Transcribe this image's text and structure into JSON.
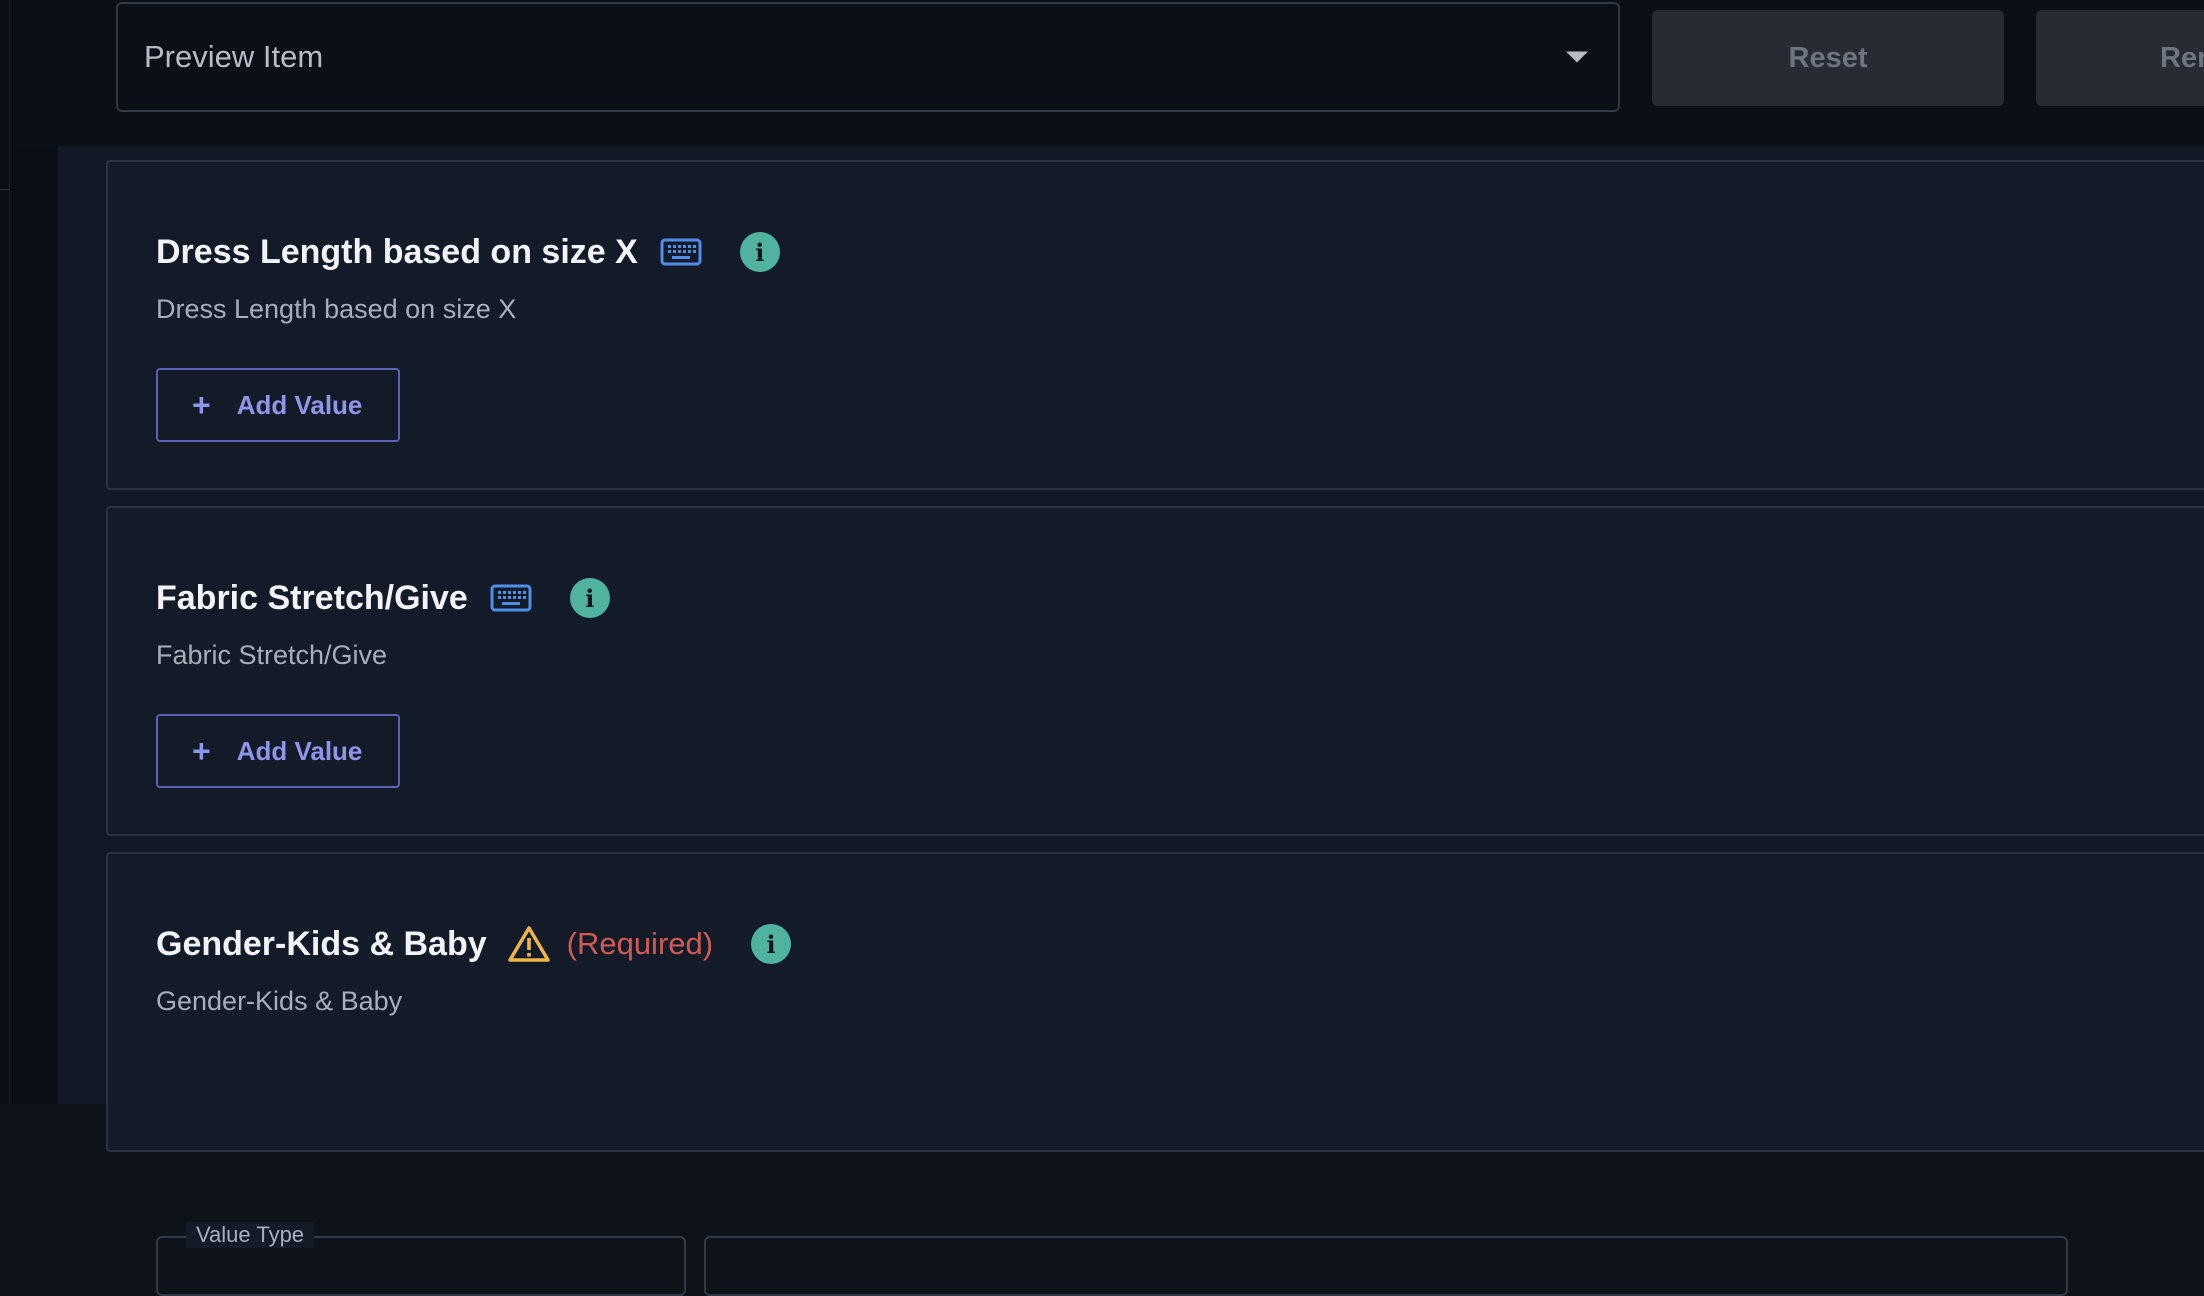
{
  "toolbar": {
    "preview_select_value": "Preview Item",
    "reset_label": "Reset",
    "ren_label": "Ren"
  },
  "cards": [
    {
      "title": "Dress Length based on size X",
      "subtitle": "Dress Length based on size X",
      "add_label": "Add Value",
      "title_icon": "keyboard-icon"
    },
    {
      "title": "Fabric Stretch/Give",
      "subtitle": "Fabric Stretch/Give",
      "add_label": "Add Value",
      "title_icon": "keyboard-icon"
    },
    {
      "title": "Gender-Kids & Baby",
      "subtitle": "Gender-Kids & Baby",
      "required_label": "(Required)",
      "value_type_label": "Value Type",
      "title_icon": "warning-icon"
    }
  ],
  "colors": {
    "info": "#4fb3a0",
    "keyboard": "#4f8fea",
    "warning": "#f0b54a",
    "required": "#d25a55",
    "accent": "#8f95e8"
  }
}
